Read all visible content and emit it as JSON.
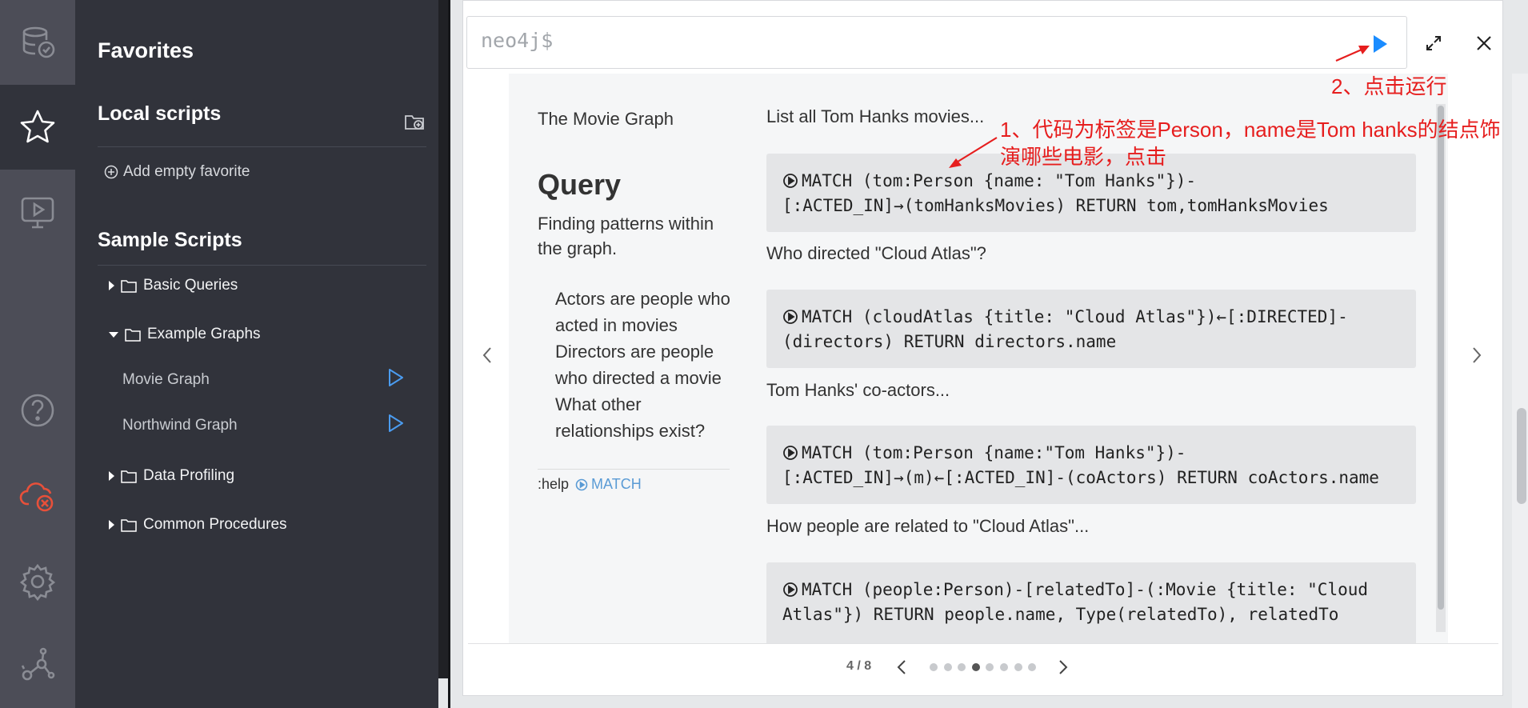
{
  "colors": {
    "accent": "#1a8cff",
    "annotation": "#e61e1e",
    "sidebar": "#31333b",
    "rail": "#4c4d57"
  },
  "rail": {
    "items": [
      {
        "icon": "database-icon"
      },
      {
        "icon": "star-icon"
      },
      {
        "icon": "monitor-play-icon"
      },
      {
        "icon": "help-icon"
      },
      {
        "icon": "cloud-disconnected-icon"
      },
      {
        "icon": "gear-icon"
      },
      {
        "icon": "graph-icon"
      }
    ]
  },
  "sidebar": {
    "title": "Favorites",
    "local_scripts": "Local scripts",
    "add_empty_favorite": "Add empty favorite",
    "sample_scripts": "Sample Scripts",
    "folders": [
      {
        "label": "Basic Queries"
      },
      {
        "label": "Example Graphs"
      },
      {
        "label": "Data Profiling"
      },
      {
        "label": "Common Procedures"
      }
    ],
    "scripts": [
      {
        "label": "Movie Graph"
      },
      {
        "label": "Northwind Graph"
      }
    ]
  },
  "editor": {
    "prompt": "neo4j$"
  },
  "slide": {
    "title": "The Movie Graph",
    "heading": "Query",
    "subheading": "Finding patterns within the graph.",
    "bullets": [
      "Actors are people who acted in movies",
      "Directors are people who directed a movie",
      "What other relationships exist?"
    ],
    "help_cmd": ":help",
    "help_link": "MATCH",
    "queries": [
      {
        "caption": "List all Tom Hanks movies...",
        "code": "MATCH (tom:Person {name: \"Tom Hanks\"})-[:ACTED_IN]→(tomHanksMovies) RETURN tom,tomHanksMovies"
      },
      {
        "caption": "Who directed \"Cloud Atlas\"?",
        "code": "MATCH (cloudAtlas {title: \"Cloud Atlas\"})←[:DIRECTED]-(directors) RETURN directors.name"
      },
      {
        "caption": "Tom Hanks' co-actors...",
        "code": "MATCH (tom:Person {name:\"Tom Hanks\"})-[:ACTED_IN]→(m)←[:ACTED_IN]-(coActors) RETURN coActors.name"
      },
      {
        "caption": "How people are related to \"Cloud Atlas\"...",
        "code": "MATCH (people:Person)-[relatedTo]-(:Movie {title: \"Cloud Atlas\"}) RETURN people.name, Type(relatedTo), relatedTo"
      }
    ]
  },
  "pager": {
    "label": "4 / 8",
    "current": 4,
    "total": 8
  },
  "annotations": {
    "step1_line1": "1、代码为标签是Person，name是Tom hanks的结点饰",
    "step1_line2": "演哪些电影，点击",
    "step2": "2、点击运行"
  }
}
